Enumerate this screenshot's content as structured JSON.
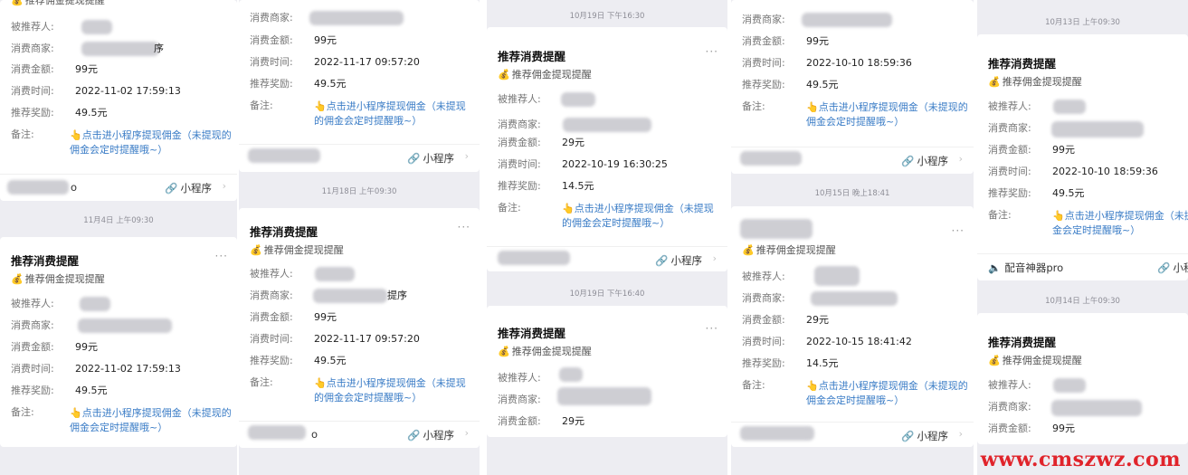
{
  "labels": {
    "title": "推荐消费提醒",
    "subtitle": "推荐佣金提现提醒",
    "referrer": "被推荐人:",
    "merchant": "消费商家:",
    "amount": "消费金额:",
    "time": "消费时间:",
    "reward": "推荐奖励:",
    "remark": "备注:",
    "remark_value": "点击进小程序提现佣金（未提现的佣金会定时提醒哦~）",
    "mini_program": "小程序",
    "more": "···"
  },
  "col1": {
    "top": {
      "amount": "99元",
      "time": "2022-11-02 17:59:13",
      "reward": "49.5元",
      "merchant_suffix": "序",
      "footer_suffix": "o"
    },
    "ts": "11月4日 上午09:30",
    "card": {
      "amount": "99元",
      "time": "2022-11-02 17:59:13",
      "reward": "49.5元"
    }
  },
  "col2": {
    "top": {
      "amount": "99元",
      "time": "2022-11-17 09:57:20",
      "reward": "49.5元"
    },
    "ts": "11月18日 上午09:30",
    "card": {
      "amount": "99元",
      "time": "2022-11-17 09:57:20",
      "reward": "49.5元",
      "merchant_suffix": "提序",
      "footer_suffix": "o"
    }
  },
  "col3": {
    "ts1": "10月19日 下午16:30",
    "card1": {
      "amount": "29元",
      "time": "2022-10-19 16:30:25",
      "reward": "14.5元"
    },
    "ts2": "10月19日 下午16:40",
    "card2": {
      "amount": "29元"
    }
  },
  "col4": {
    "top": {
      "amount": "99元",
      "time": "2022-10-10 18:59:36",
      "reward": "49.5元"
    },
    "ts": "10月15日 晚上18:41",
    "card": {
      "amount": "29元",
      "time": "2022-10-15 18:41:42",
      "reward": "14.5元"
    }
  },
  "col5": {
    "ts1": "10月13日 上午09:30",
    "card1": {
      "amount": "99元",
      "time": "2022-10-10 18:59:36",
      "reward": "49.5元",
      "app_name": "配音神器pro"
    },
    "ts2": "10月14日 上午09:30",
    "card2": {
      "amount": "99元"
    }
  },
  "watermark": "www.cmszwz.com"
}
